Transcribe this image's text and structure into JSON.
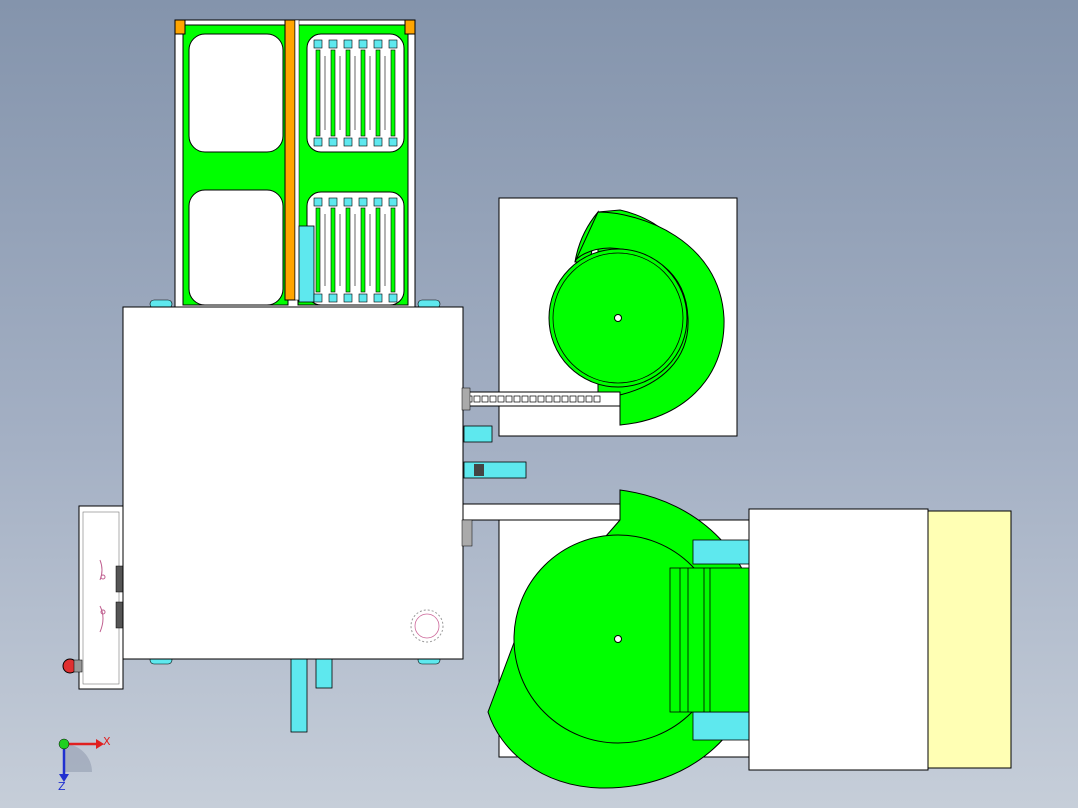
{
  "colors": {
    "background_top": "#8494ac",
    "background_bottom": "#c6ced9",
    "green": "#00ff00",
    "orange": "#ffa500",
    "cyan": "#5ee8ee",
    "pale_yellow": "#ffffb4",
    "white": "#ffffff",
    "outline": "#000000"
  },
  "triad": {
    "x_label": "X",
    "z_label": "Z"
  },
  "icons": [
    "coordinate-triad-icon",
    "emergency-stop-icon"
  ]
}
